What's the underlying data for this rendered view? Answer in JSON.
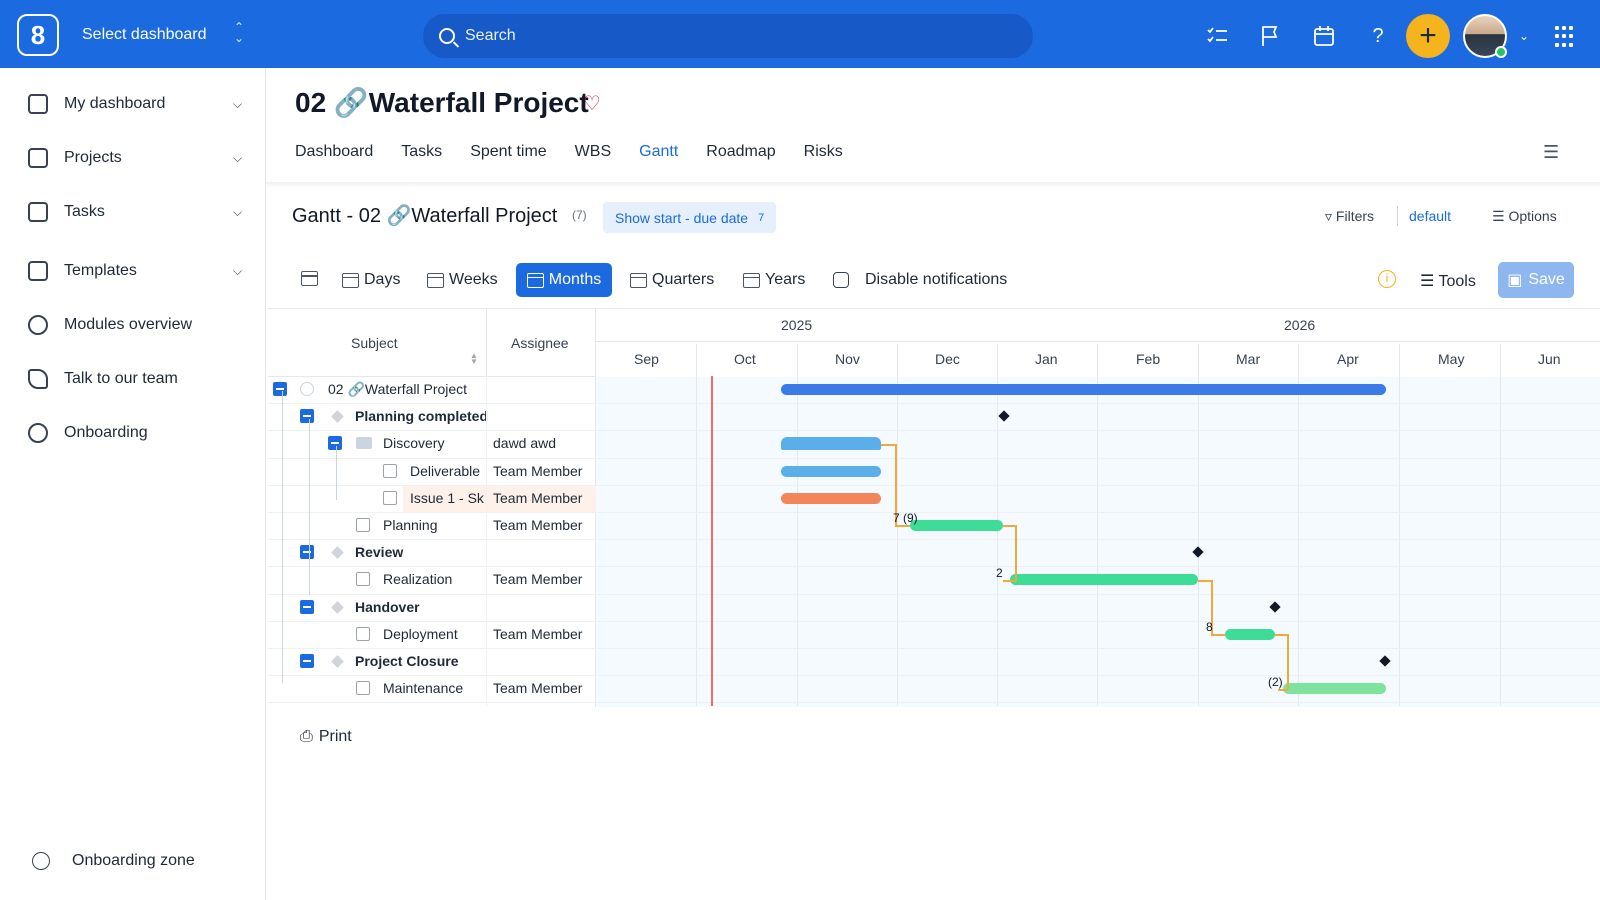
{
  "topbar": {
    "logo": "8",
    "dashboard_select": "Select dashboard",
    "search_placeholder": "Search",
    "icons": [
      "tasklist-icon",
      "flag-icon",
      "calendar-icon",
      "help-icon",
      "plus-icon",
      "avatar",
      "apps-grid-icon"
    ],
    "help_label": "?",
    "plus_label": "+"
  },
  "sidebar": {
    "items": [
      {
        "label": "My dashboard",
        "icon": "dashboard-icon",
        "chevron": true
      },
      {
        "label": "Projects",
        "icon": "projects-icon",
        "chevron": true
      },
      {
        "label": "Tasks",
        "icon": "tasks-icon",
        "chevron": true
      },
      {
        "label": "Templates",
        "icon": "templates-icon",
        "chevron": true
      },
      {
        "label": "Modules overview",
        "icon": "info-icon",
        "chevron": false
      },
      {
        "label": "Talk to our team",
        "icon": "phone-icon",
        "chevron": false
      },
      {
        "label": "Onboarding",
        "icon": "bulb-icon",
        "chevron": false
      }
    ],
    "footer": "Onboarding zone"
  },
  "project": {
    "title": "02 🔗Waterfall Project",
    "tabs": [
      "Dashboard",
      "Tasks",
      "Spent time",
      "WBS",
      "Gantt",
      "Roadmap",
      "Risks"
    ],
    "active_tab": "Gantt"
  },
  "gantt_header": {
    "title": "Gantt - 02 🔗Waterfall Project",
    "count": "(7)",
    "show_dates": "Show start - due date",
    "show_dates_count": "7",
    "filters": "Filters",
    "filter_preset": "default",
    "options": "Options"
  },
  "toolbar": {
    "days": "Days",
    "weeks": "Weeks",
    "months": "Months",
    "quarters": "Quarters",
    "years": "Years",
    "disable_notifications": "Disable notifications",
    "tools": "Tools",
    "save": "Save",
    "info_glyph": "i"
  },
  "columns": {
    "subject": "Subject",
    "assignee": "Assignee"
  },
  "timeline": {
    "years": [
      "2025",
      "2026"
    ],
    "months": [
      "Sep",
      "Oct",
      "Nov",
      "Dec",
      "Jan",
      "Feb",
      "Mar",
      "Apr",
      "May",
      "Jun"
    ]
  },
  "rows": [
    {
      "subject": "02 🔗Waterfall Project",
      "assignee": "",
      "kind": "project"
    },
    {
      "subject": "Planning completed",
      "assignee": "",
      "kind": "milestone"
    },
    {
      "subject": "Discovery",
      "assignee": "dawd awd",
      "kind": "folder"
    },
    {
      "subject": "Deliverable",
      "assignee": "Team Member",
      "kind": "task"
    },
    {
      "subject": "Issue 1 - Sk",
      "assignee": "Team Member",
      "kind": "task"
    },
    {
      "subject": "Planning",
      "assignee": "Team Member",
      "kind": "task"
    },
    {
      "subject": "Review",
      "assignee": "",
      "kind": "milestone"
    },
    {
      "subject": "Realization",
      "assignee": "Team Member",
      "kind": "task"
    },
    {
      "subject": "Handover",
      "assignee": "",
      "kind": "milestone"
    },
    {
      "subject": "Deployment",
      "assignee": "Team Member",
      "kind": "task"
    },
    {
      "subject": "Project Closure",
      "assignee": "",
      "kind": "milestone"
    },
    {
      "subject": "Maintenance",
      "assignee": "Team Member",
      "kind": "task"
    }
  ],
  "dependency_labels": [
    "7 (9)",
    "2",
    "8",
    "(2)"
  ],
  "colors": {
    "accent": "#1b6ae0",
    "project_bar": "#3b7be6",
    "discovery_bar": "#5aaeea",
    "issue_bar": "#f2865a",
    "task_bar": "#3ddc97",
    "maintenance_bar": "#7ee39d",
    "dependency": "#f2a93b",
    "today_line": "#ef6b6b",
    "plus_button": "#f5b31d"
  },
  "footer": {
    "print": "Print"
  }
}
